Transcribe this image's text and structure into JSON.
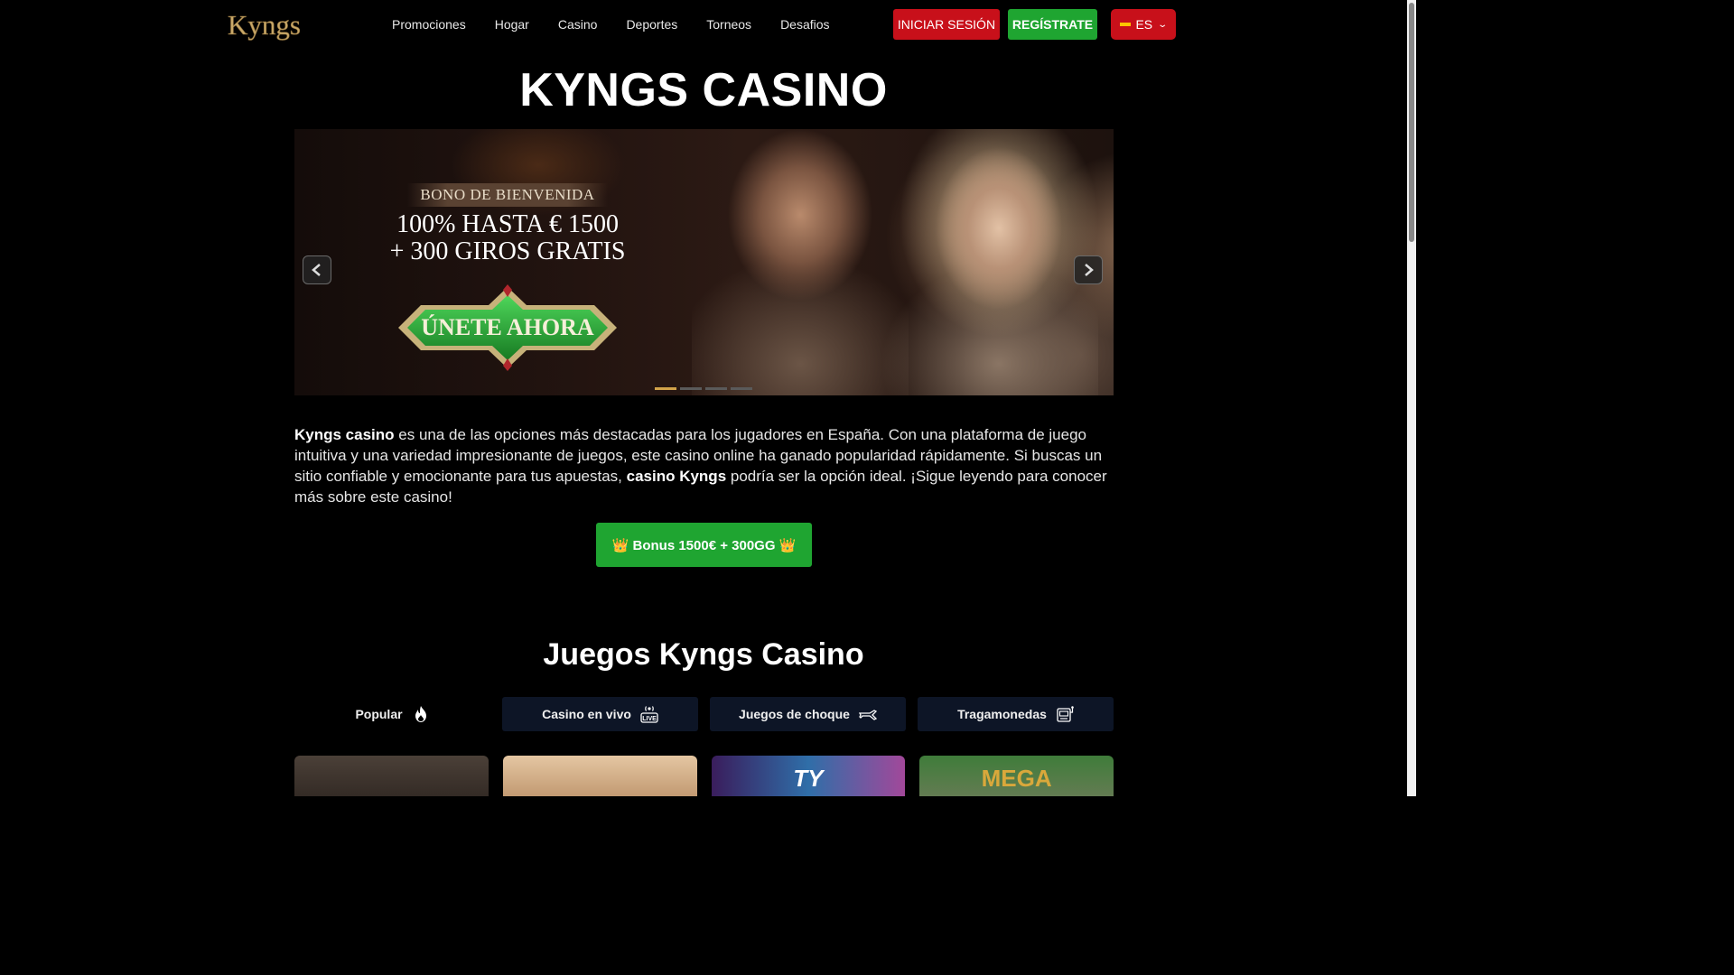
{
  "header": {
    "logo_text": "Kyngs",
    "nav": [
      "Promociones",
      "Hogar",
      "Casino",
      "Deportes",
      "Torneos",
      "Desafios"
    ],
    "login_label": "INICIAR SESIÓN",
    "register_label": "REGÍSTRATE",
    "language": "ES"
  },
  "page_title": "KYNGS CASINO",
  "banner": {
    "label": "BONO DE BIENVENIDA",
    "line1": "100% HASTA € 1500",
    "line2": "+ 300 GIROS GRATIS",
    "cta": "ÚNETE AHORA",
    "slide_count": 4,
    "active_slide": 1
  },
  "intro": {
    "bold1": "Kyngs casino",
    "text1": " es una de las opciones más destacadas para los jugadores en España. Con una plataforma de juego intuitiva y una variedad impresionante de juegos, este casino online ha ganado popularidad rápidamente. Si buscas un sitio confiable y emocionante para tus apuestas, ",
    "bold2": "casino Kyngs",
    "text2": " podría ser la opción ideal. ¡Sigue leyendo para conocer más sobre este casino!"
  },
  "bonus_button": "👑 Bonus 1500€ + 300GG 👑",
  "games_section": {
    "title": "Juegos Kyngs Casino",
    "tabs": [
      {
        "label": "Popular",
        "icon": "flame-icon"
      },
      {
        "label": "Casino en vivo",
        "icon": "live-icon"
      },
      {
        "label": "Juegos de choque",
        "icon": "plane-icon"
      },
      {
        "label": "Tragamonedas",
        "icon": "slot-machine-icon"
      }
    ],
    "card_labels": [
      "",
      "",
      "TY",
      "MEGA"
    ]
  },
  "colors": {
    "login": "#c8101a",
    "register": "#1fa531",
    "language": "#c8101a",
    "tab_bg": "#0d1526",
    "slide_active": "#d2a34a"
  }
}
